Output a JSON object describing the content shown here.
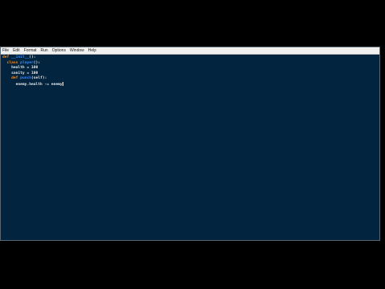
{
  "menu": [
    "File",
    "Edit",
    "Format",
    "Run",
    "Options",
    "Window",
    "Help"
  ],
  "code": [
    {
      "indent": "",
      "tokens": [
        {
          "t": "def",
          "c": "kw"
        },
        {
          "t": " ",
          "c": ""
        },
        {
          "t": "__init__",
          "c": "fn"
        },
        {
          "t": "():",
          "c": ""
        }
      ]
    },
    {
      "indent": "  ",
      "tokens": [
        {
          "t": "class",
          "c": "kw"
        },
        {
          "t": " ",
          "c": ""
        },
        {
          "t": "player",
          "c": "fn"
        },
        {
          "t": "():",
          "c": ""
        }
      ]
    },
    {
      "indent": "    ",
      "tokens": [
        {
          "t": "health = 100",
          "c": ""
        }
      ]
    },
    {
      "indent": "    ",
      "tokens": [
        {
          "t": "sanity = 100",
          "c": ""
        }
      ]
    },
    {
      "indent": "    ",
      "tokens": [
        {
          "t": "def",
          "c": "kw"
        },
        {
          "t": " ",
          "c": ""
        },
        {
          "t": "punch",
          "c": "fn"
        },
        {
          "t": "(self):",
          "c": ""
        }
      ]
    },
    {
      "indent": "      ",
      "tokens": [
        {
          "t": "enemy.health -= enemy",
          "c": ""
        }
      ]
    }
  ]
}
